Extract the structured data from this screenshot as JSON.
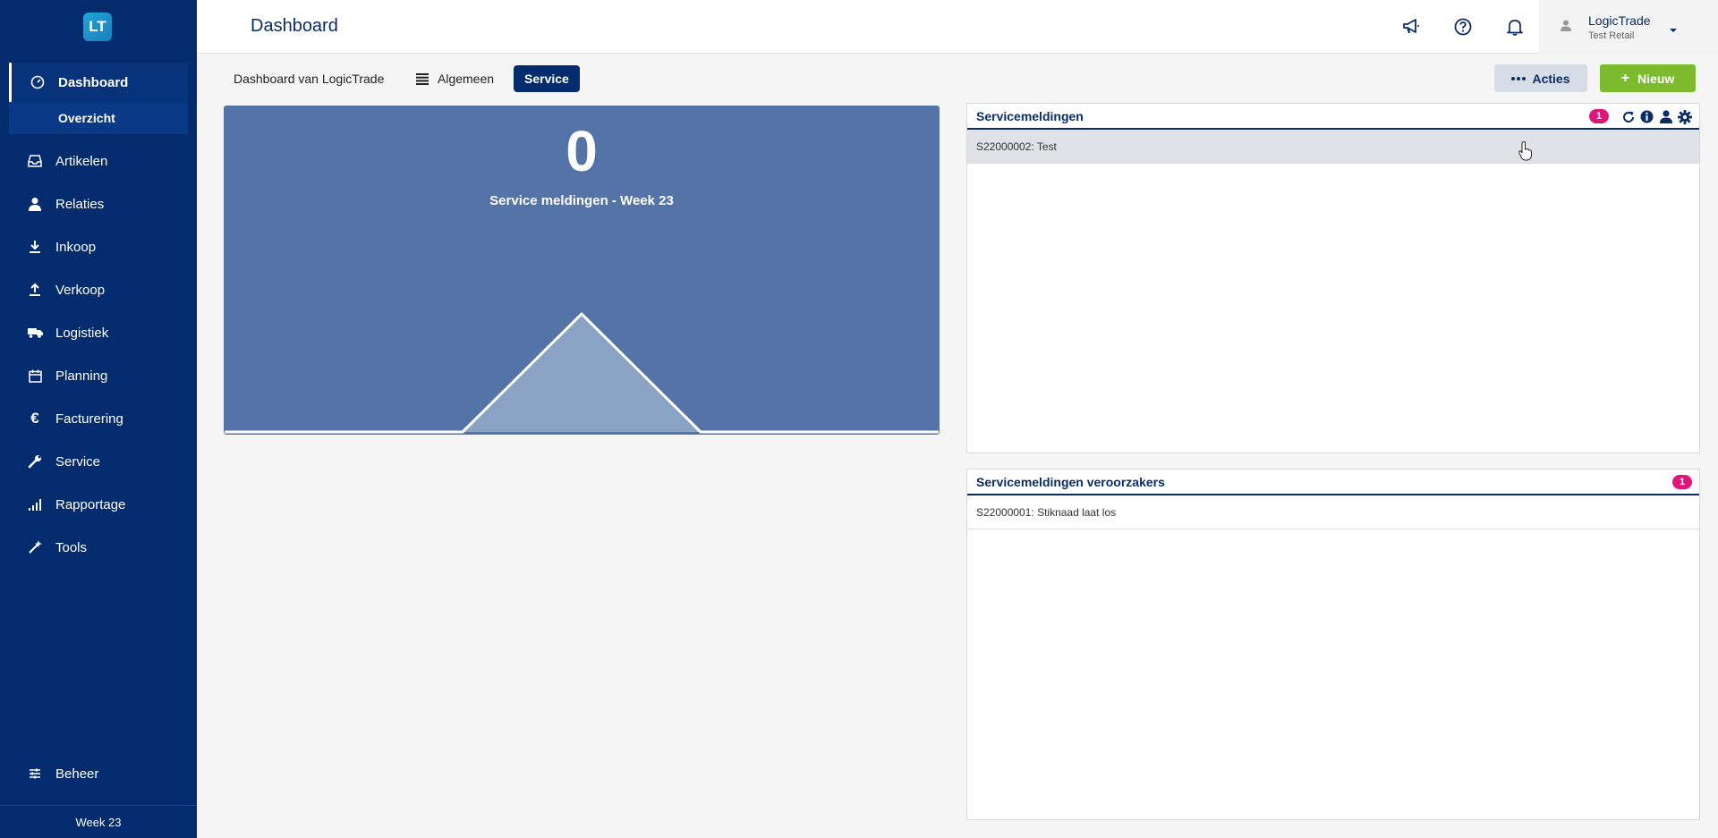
{
  "app": {
    "logo_text": "LT",
    "week_footer": "Week 23"
  },
  "sidebar": {
    "items": [
      {
        "label": "Dashboard",
        "icon": "dashboard-icon"
      },
      {
        "label": "Artikelen",
        "icon": "inbox-icon"
      },
      {
        "label": "Relaties",
        "icon": "person-icon"
      },
      {
        "label": "Inkoop",
        "icon": "download-icon"
      },
      {
        "label": "Verkoop",
        "icon": "upload-icon"
      },
      {
        "label": "Logistiek",
        "icon": "truck-icon"
      },
      {
        "label": "Planning",
        "icon": "calendar-icon"
      },
      {
        "label": "Facturering",
        "icon": "euro-icon"
      },
      {
        "label": "Service",
        "icon": "wrench-icon"
      },
      {
        "label": "Rapportage",
        "icon": "bar-chart-icon"
      },
      {
        "label": "Tools",
        "icon": "magic-wand-icon"
      }
    ],
    "sub_item": "Overzicht",
    "bottom_item": "Beheer"
  },
  "header": {
    "title": "Dashboard",
    "user_name": "LogicTrade",
    "user_company": "Test Retail"
  },
  "tabs": {
    "dashboard_van": "Dashboard van LogicTrade",
    "algemeen": "Algemeen",
    "service": "Service"
  },
  "actions": {
    "acties": "Acties",
    "nieuw": "Nieuw"
  },
  "widget": {
    "number": "0",
    "label": "Service meldingen - Week 23",
    "chart_data": {
      "type": "area",
      "values": [
        0,
        0,
        0,
        1,
        0,
        0,
        0
      ],
      "color": "#8aa2c4"
    }
  },
  "panel1": {
    "title": "Servicemeldingen",
    "count": "1",
    "rows": [
      "S22000002: Test"
    ]
  },
  "panel2": {
    "title": "Servicemeldingen veroorzakers",
    "count": "1",
    "rows": [
      "S22000001: Stiknaad laat los"
    ]
  },
  "colors": {
    "sidebar": "#032c6e",
    "accent_green": "#7dbb2e",
    "badge": "#e0157a",
    "widget": "#5474a7"
  }
}
